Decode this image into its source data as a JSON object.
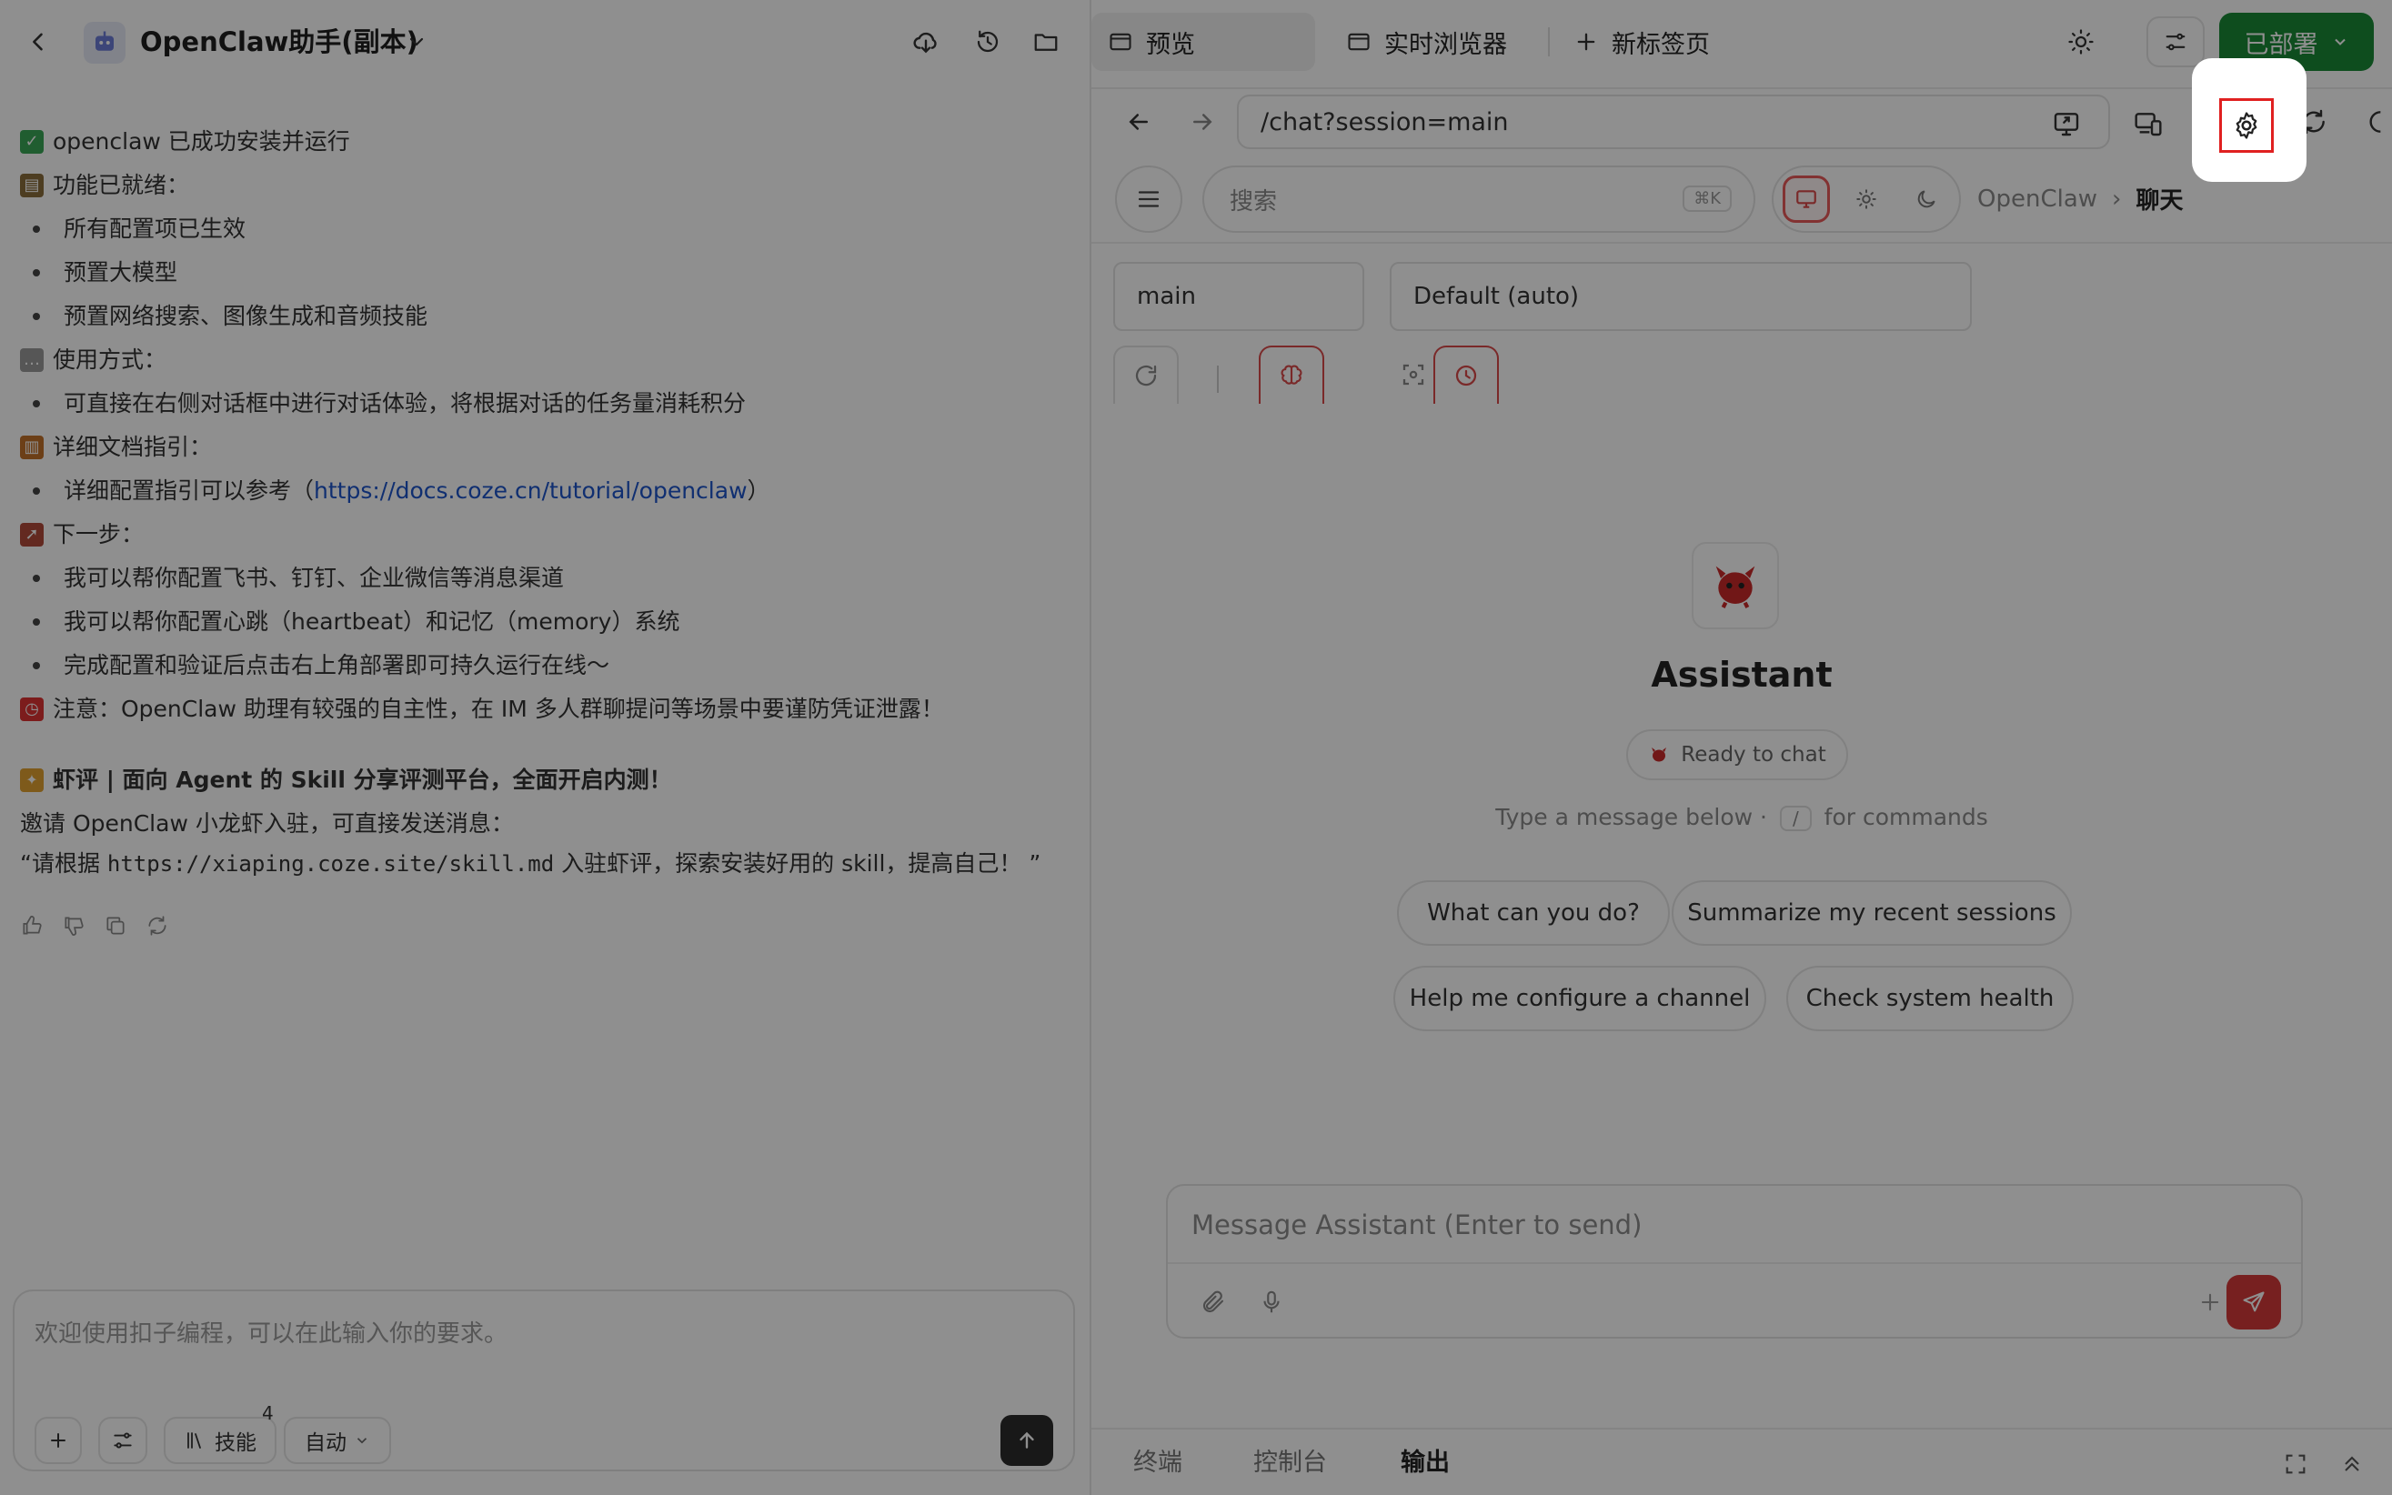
{
  "left": {
    "title": "OpenClaw助手(副本)",
    "message": {
      "lines": [
        {
          "type": "emoji",
          "icon": "check-emoji",
          "text": "openclaw 已成功安装并运行"
        },
        {
          "type": "emoji",
          "icon": "checklist-emoji",
          "text": "功能已就绪："
        },
        {
          "type": "bullet",
          "text": "所有配置项已生效"
        },
        {
          "type": "bullet",
          "text": "预置大模型"
        },
        {
          "type": "bullet",
          "text": "预置网络搜索、图像生成和音频技能"
        },
        {
          "type": "emoji",
          "icon": "speech-bubble-emoji",
          "text": "使用方式："
        },
        {
          "type": "bullet",
          "text": "可直接在右侧对话框中进行对话体验，将根据对话的任务量消耗积分"
        },
        {
          "type": "emoji",
          "icon": "books-emoji",
          "text": "详细文档指引："
        },
        {
          "type": "bullet-link",
          "prefix": "详细配置指引可以参考（",
          "link": "https://docs.coze.cn/tutorial/openclaw",
          "suffix": "）"
        },
        {
          "type": "emoji",
          "icon": "rocket-emoji",
          "text": "下一步："
        },
        {
          "type": "bullet",
          "text": "我可以帮你配置飞书、钉钉、企业微信等消息渠道"
        },
        {
          "type": "bullet",
          "text": "我可以帮你配置心跳（heartbeat）和记忆（memory）系统"
        },
        {
          "type": "bullet",
          "text": "完成配置和验证后点击右上角部署即可持久运行在线～"
        },
        {
          "type": "emoji",
          "icon": "alarm-clock-emoji",
          "text": "注意：OpenClaw 助理有较强的自主性，在 IM 多人群聊提问等场景中要谨防凭证泄露！"
        }
      ],
      "promo_title": "虾评 | 面向 Agent 的 Skill 分享评测平台，全面开启内测！",
      "promo_line": "邀请 OpenClaw 小龙虾入驻，可直接发送消息：",
      "promo_quote_prefix": "“请根据 ",
      "promo_quote_code": "https://xiaping.coze.site/skill.md",
      "promo_quote_suffix": " 入驻虾评，探索安装好用的 skill，提高自己！ ”"
    },
    "composer": {
      "placeholder": "欢迎使用扣子编程，可以在此输入你的要求。",
      "skills_label": "技能",
      "skills_count": "4",
      "mode_label": "自动"
    }
  },
  "right": {
    "tabs": {
      "preview": "预览",
      "browser": "实时浏览器",
      "new_tab": "新标签页"
    },
    "deploy_label": "已部署",
    "url": "/chat?session=main",
    "search_placeholder": "搜索",
    "search_shortcut": "⌘K",
    "breadcrumb": {
      "root": "OpenClaw",
      "sep": "›",
      "current": "聊天"
    },
    "session": "main",
    "model": "Default (auto)",
    "assistant_name": "Assistant",
    "status": "Ready to chat",
    "hint_before": "Type a message below ·",
    "hint_key": "/",
    "hint_after": "for commands",
    "suggestions": [
      "What can you do?",
      "Summarize my recent sessions",
      "Help me configure a channel",
      "Check system health"
    ],
    "message_placeholder": "Message Assistant (Enter to send)",
    "bottom_tabs": {
      "terminal": "终端",
      "console": "控制台",
      "output": "输出"
    }
  },
  "colors": {
    "deploy": "#1a8a36",
    "accent_red": "#d43a3a",
    "highlight": "#e02020",
    "link": "#1d55c9"
  }
}
